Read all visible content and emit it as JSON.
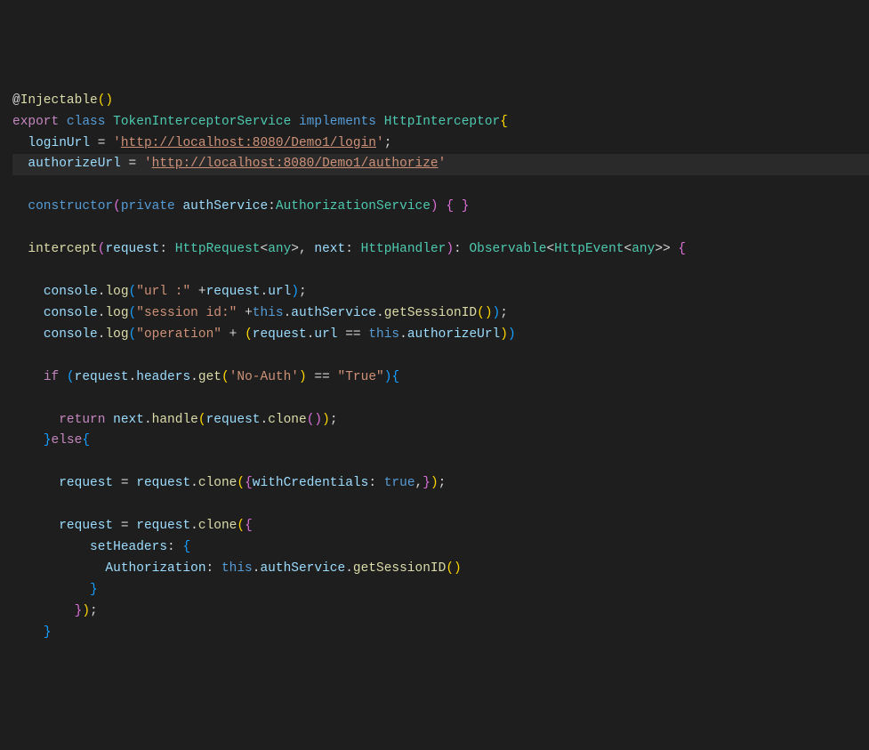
{
  "code": {
    "decorator": "@",
    "decorator_name": "Injectable",
    "export": "export",
    "class": "class",
    "classname": "TokenInterceptorService",
    "implements": "implements",
    "interface": "HttpInterceptor",
    "loginUrl_prop": "loginUrl",
    "loginUrl_val": "http://localhost:8080/Demo1/login",
    "authorizeUrl_prop": "authorizeUrl",
    "authorizeUrl_val": "http://localhost:8080/Demo1/authorize",
    "constructor": "constructor",
    "private": "private",
    "authService_param": "authService",
    "AuthorizationService": "AuthorizationService",
    "intercept": "intercept",
    "request_param": "request",
    "HttpRequest": "HttpRequest",
    "any": "any",
    "next_param": "next",
    "HttpHandler": "HttpHandler",
    "Observable": "Observable",
    "HttpEvent": "HttpEvent",
    "console": "console",
    "log": "log",
    "url_str": "\"url :\"",
    "request_var": "request",
    "url_prop": "url",
    "session_str": "\"session id:\"",
    "this": "this",
    "authService_prop": "authService",
    "getSessionID": "getSessionID",
    "operation_str": "\"operation\"",
    "authorizeUrl_ref": "authorizeUrl",
    "if": "if",
    "headers_prop": "headers",
    "get": "get",
    "noauth_str": "'No-Auth'",
    "true_str": "\"True\"",
    "return": "return",
    "next_var": "next",
    "handle": "handle",
    "clone": "clone",
    "else": "else",
    "withCredentials": "withCredentials",
    "true": "true",
    "setHeaders": "setHeaders",
    "Authorization": "Authorization",
    "eq": " = ",
    "eqeq": " == ",
    "plus": " +",
    "plus2": " + "
  }
}
